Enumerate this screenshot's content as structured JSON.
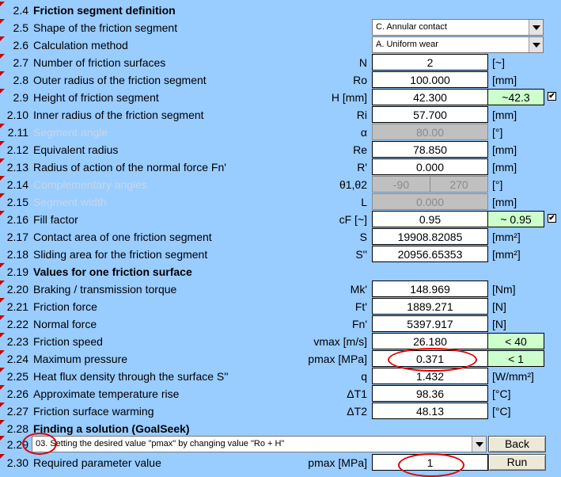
{
  "rows": [
    {
      "num": "2.4",
      "label": "Friction segment definition"
    },
    {
      "num": "2.5",
      "label": "Shape of the friction segment",
      "value": "C. Annular contact"
    },
    {
      "num": "2.6",
      "label": "Calculation method",
      "value": "A. Uniform wear"
    },
    {
      "num": "2.7",
      "label": "Number of friction surfaces",
      "sym": "N",
      "value": "2",
      "unit": "[~]"
    },
    {
      "num": "2.8",
      "label": "Outer radius of the friction segment",
      "sym": "Ro",
      "value": "100.000",
      "unit": "[mm]"
    },
    {
      "num": "2.9",
      "label": "Height of friction segment",
      "sym": "H [mm]",
      "value": "42.300",
      "green": "~42.3"
    },
    {
      "num": "2.10",
      "label": "Inner radius of the friction segment",
      "sym": "Ri",
      "value": "57.700",
      "unit": "[mm]"
    },
    {
      "num": "2.11",
      "label": "Segment angle",
      "sym": "α",
      "value": "80.00",
      "unit": "[°]"
    },
    {
      "num": "2.12",
      "label": "Equivalent radius",
      "sym": "Re",
      "value": "78.850",
      "unit": "[mm]"
    },
    {
      "num": "2.13",
      "label": "Radius of action of the normal force Fn'",
      "sym": "R'",
      "value": "0.000",
      "unit": "[mm]"
    },
    {
      "num": "2.14",
      "label": "Complementary angles",
      "sym": "θ1,θ2",
      "value1": "-90",
      "value2": "270",
      "unit": "[°]"
    },
    {
      "num": "2.15",
      "label": "Segment width",
      "sym": "L",
      "value": "0.000",
      "unit": "[mm]"
    },
    {
      "num": "2.16",
      "label": "Fill factor",
      "sym": "cF [~]",
      "value": "0.95",
      "green": "~ 0.95"
    },
    {
      "num": "2.17",
      "label": "Contact area of one friction segment",
      "sym": "S",
      "value": "19908.82085",
      "unit": "[mm²]"
    },
    {
      "num": "2.18",
      "label": "Sliding area for the friction segment",
      "sym": "S''",
      "value": "20956.65353",
      "unit": "[mm²]"
    },
    {
      "num": "2.19",
      "label": "Values for one friction surface"
    },
    {
      "num": "2.20",
      "label": "Braking / transmission torque",
      "sym": "Mk'",
      "value": "148.969",
      "unit": "[Nm]"
    },
    {
      "num": "2.21",
      "label": "Friction force",
      "sym": "Ft'",
      "value": "1889.271",
      "unit": "[N]"
    },
    {
      "num": "2.22",
      "label": "Normal force",
      "sym": "Fn'",
      "value": "5397.917",
      "unit": "[N]"
    },
    {
      "num": "2.23",
      "label": "Friction speed",
      "sym": "vmax [m/s]",
      "value": "26.180",
      "green": "< 40"
    },
    {
      "num": "2.24",
      "label": "Maximum pressure",
      "sym": "pmax [MPa]",
      "value": "0.371",
      "green": "< 1"
    },
    {
      "num": "2.25",
      "label": "Heat flux density through the surface S''",
      "sym": "q",
      "value": "1.432",
      "unit": "[W/mm²]"
    },
    {
      "num": "2.26",
      "label": "Approximate temperature rise",
      "sym": "ΔT1",
      "value": "98.36",
      "unit": "[°C]"
    },
    {
      "num": "2.27",
      "label": "Friction surface warming",
      "sym": "ΔT2",
      "value": "48.13",
      "unit": "[°C]"
    },
    {
      "num": "2.28",
      "label": "Finding a solution (GoalSeek)"
    },
    {
      "num": "2.29",
      "value": "03. Setting the desired value \"pmax\" by changing value \"Ro + H\"",
      "button": "Back"
    },
    {
      "num": "2.30",
      "label": "Required parameter value",
      "sym": "pmax [MPa]",
      "value": "1",
      "button": "Run"
    }
  ],
  "checkbox_mark": "✔",
  "colors": {
    "background": "#99CCFF",
    "green_cell": "#CCFFCC",
    "highlight": "#E00000",
    "disabled": "#C0C0C0"
  }
}
